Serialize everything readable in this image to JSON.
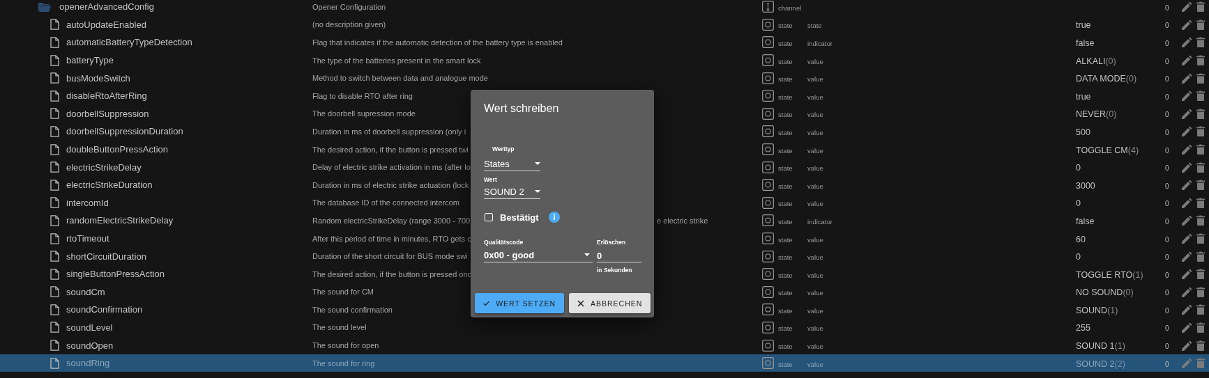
{
  "rows": [
    {
      "kind": "folder",
      "name": "openerAdvancedConfig",
      "description": "Opener Configuration",
      "type": "channel",
      "count": "0",
      "selected": false
    },
    {
      "kind": "state",
      "name": "autoUpdateEnabled",
      "description": "(no description given)",
      "type": "state",
      "role": "state",
      "value": "true",
      "count": "0",
      "selected": false
    },
    {
      "kind": "state",
      "name": "automaticBatteryTypeDetection",
      "description": "Flag that indicates if the automatic detection of the battery type is enabled",
      "type": "state",
      "role": "indicator",
      "value": "false",
      "count": "0",
      "selected": false
    },
    {
      "kind": "state",
      "name": "batteryType",
      "description": "The type of the batteries present in the smart lock",
      "type": "state",
      "role": "value",
      "value": "ALKALI",
      "value_code": "(0)",
      "count": "0",
      "selected": false
    },
    {
      "kind": "state",
      "name": "busModeSwitch",
      "description": "Method to switch between data and analogue mode",
      "type": "state",
      "role": "value",
      "value": "DATA MODE",
      "value_code": "(0)",
      "count": "0",
      "selected": false
    },
    {
      "kind": "state",
      "name": "disableRtoAfterRing",
      "description": "Flag to disable RTO after ring",
      "type": "state",
      "role": "value",
      "value": "true",
      "count": "0",
      "selected": false
    },
    {
      "kind": "state",
      "name": "doorbellSuppression",
      "description": "The doorbell supression mode",
      "type": "state",
      "role": "value",
      "value": "NEVER",
      "value_code": "(0)",
      "count": "0",
      "selected": false
    },
    {
      "kind": "state",
      "name": "doorbellSuppressionDuration",
      "description": "Duration in ms of doorbell suppression (only i",
      "type": "state",
      "role": "value",
      "value": "500",
      "count": "0",
      "selected": false
    },
    {
      "kind": "state",
      "name": "doubleButtonPressAction",
      "description": "The desired action, if the button is pressed twi",
      "type": "state",
      "role": "value",
      "value": "TOGGLE CM",
      "value_code": "(4)",
      "count": "0",
      "selected": false
    },
    {
      "kind": "state",
      "name": "electricStrikeDelay",
      "description": "Delay of electric strike activation in ms (after lo",
      "type": "state",
      "role": "value",
      "value": "0",
      "count": "0",
      "selected": false
    },
    {
      "kind": "state",
      "name": "electricStrikeDuration",
      "description": "Duration in ms of electric strike actuation (lock",
      "type": "state",
      "role": "value",
      "value": "3000",
      "count": "0",
      "selected": false
    },
    {
      "kind": "state",
      "name": "intercomId",
      "description": "The database ID of the connected intercom",
      "type": "state",
      "role": "value",
      "value": "0",
      "count": "0",
      "selected": false
    },
    {
      "kind": "state",
      "name": "randomElectricStrikeDelay",
      "description": "Random electricStrikeDelay (range 3000 - 700",
      "description_tail": "e electric strike",
      "type": "state",
      "role": "indicator",
      "value": "false",
      "count": "0",
      "selected": false
    },
    {
      "kind": "state",
      "name": "rtoTimeout",
      "description": "After this period of time in minutes, RTO gets c",
      "type": "state",
      "role": "value",
      "value": "60",
      "count": "0",
      "selected": false
    },
    {
      "kind": "state",
      "name": "shortCircuitDuration",
      "description": "Duration of the short circuit for BUS mode swi",
      "type": "state",
      "role": "value",
      "value": "0",
      "count": "0",
      "selected": false
    },
    {
      "kind": "state",
      "name": "singleButtonPressAction",
      "description": "The desired action, if the button is pressed onc",
      "type": "state",
      "role": "value",
      "value": "TOGGLE RTO",
      "value_code": "(1)",
      "count": "0",
      "selected": false
    },
    {
      "kind": "state",
      "name": "soundCm",
      "description": "The sound for CM",
      "type": "state",
      "role": "value",
      "value": "NO SOUND",
      "value_code": "(0)",
      "count": "0",
      "selected": false
    },
    {
      "kind": "state",
      "name": "soundConfirmation",
      "description": "The sound confirmation",
      "type": "state",
      "role": "value",
      "value": "SOUND",
      "value_code": "(1)",
      "count": "0",
      "selected": false
    },
    {
      "kind": "state",
      "name": "soundLevel",
      "description": "The sound level",
      "type": "state",
      "role": "value",
      "value": "255",
      "count": "0",
      "selected": false
    },
    {
      "kind": "state",
      "name": "soundOpen",
      "description": "The sound for open",
      "type": "state",
      "role": "value",
      "value": "SOUND 1",
      "value_code": "(1)",
      "count": "0",
      "selected": false
    },
    {
      "kind": "state",
      "name": "soundRing",
      "description": "The sound for ring",
      "type": "state",
      "role": "value",
      "value": "SOUND 2",
      "value_code": "(2)",
      "count": "0",
      "selected": true
    }
  ],
  "dialog": {
    "title": "Wert schreiben",
    "value_type": {
      "label": "Werttyp",
      "value": "States"
    },
    "value": {
      "label": "Wert",
      "value": "SOUND 2"
    },
    "confirmed": {
      "label": "Bestätigt",
      "checked": false
    },
    "quality": {
      "label": "Qualitätscode",
      "value": "0x00 - good"
    },
    "expire": {
      "label": "Erlöschen",
      "value": "0",
      "helper": "in Sekunden"
    },
    "buttons": [
      {
        "kind": "primary",
        "label": "WERT SETZEN"
      },
      {
        "kind": "cancel",
        "label": "ABBRECHEN"
      }
    ]
  }
}
